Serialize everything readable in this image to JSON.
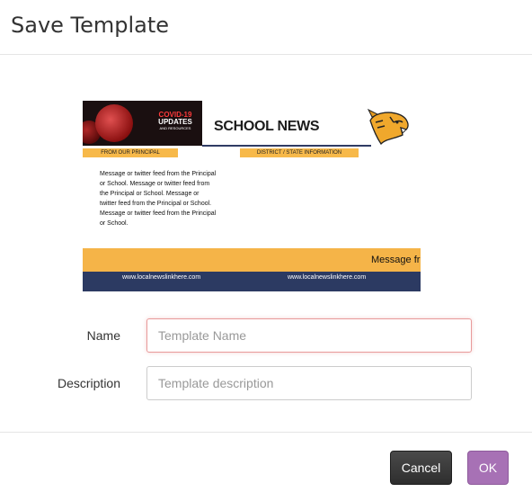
{
  "dialog": {
    "title": "Save Template"
  },
  "preview": {
    "covid_line1": "COVID-19",
    "covid_line2": "UPDATES",
    "covid_line3": "AND RESOURCES",
    "headline": "SCHOOL NEWS",
    "section_left": "FROM OUR PRINCIPAL",
    "section_right": "DISTRICT / STATE INFORMATION",
    "message": "Message or twitter feed from the Principal or School. Message or twitter feed from the Principal or School.  Message or twitter feed from the Principal or School. Message or twitter feed from the Principal or School.",
    "marquee": "Message fr",
    "link1": "www.localnewslinkhere.com",
    "link2": "www.localnewslinkhere.com",
    "colors": {
      "accent": "#f5b448",
      "navy": "#2c3a62"
    }
  },
  "form": {
    "name_label": "Name",
    "name_placeholder": "Template Name",
    "name_value": "",
    "description_label": "Description",
    "description_placeholder": "Template description",
    "description_value": ""
  },
  "buttons": {
    "cancel": "Cancel",
    "ok": "OK",
    "ok_color": "#a771b5"
  }
}
